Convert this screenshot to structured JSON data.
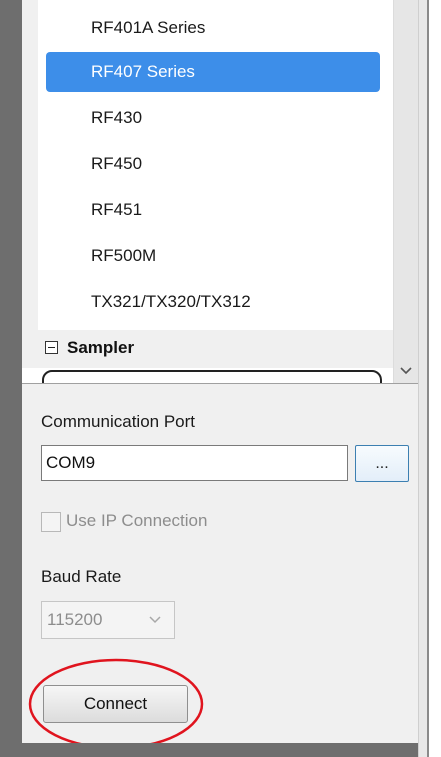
{
  "device_tree": {
    "items": [
      {
        "label": "RF401A Series",
        "selected": false
      },
      {
        "label": "RF407 Series",
        "selected": true
      },
      {
        "label": "RF430",
        "selected": false
      },
      {
        "label": "RF450",
        "selected": false
      },
      {
        "label": "RF451",
        "selected": false
      },
      {
        "label": "RF500M",
        "selected": false
      },
      {
        "label": "TX321/TX320/TX312",
        "selected": false
      }
    ],
    "group": {
      "label": "Sampler",
      "expanded": true
    }
  },
  "connection": {
    "port_label": "Communication Port",
    "port_value": "COM9",
    "browse_label": "...",
    "ip_checkbox_label": "Use IP Connection",
    "ip_checkbox_checked": false,
    "baud_label": "Baud Rate",
    "baud_value": "115200",
    "connect_label": "Connect"
  },
  "colors": {
    "selection": "#3d8ee9",
    "annotation": "#e0141e"
  }
}
